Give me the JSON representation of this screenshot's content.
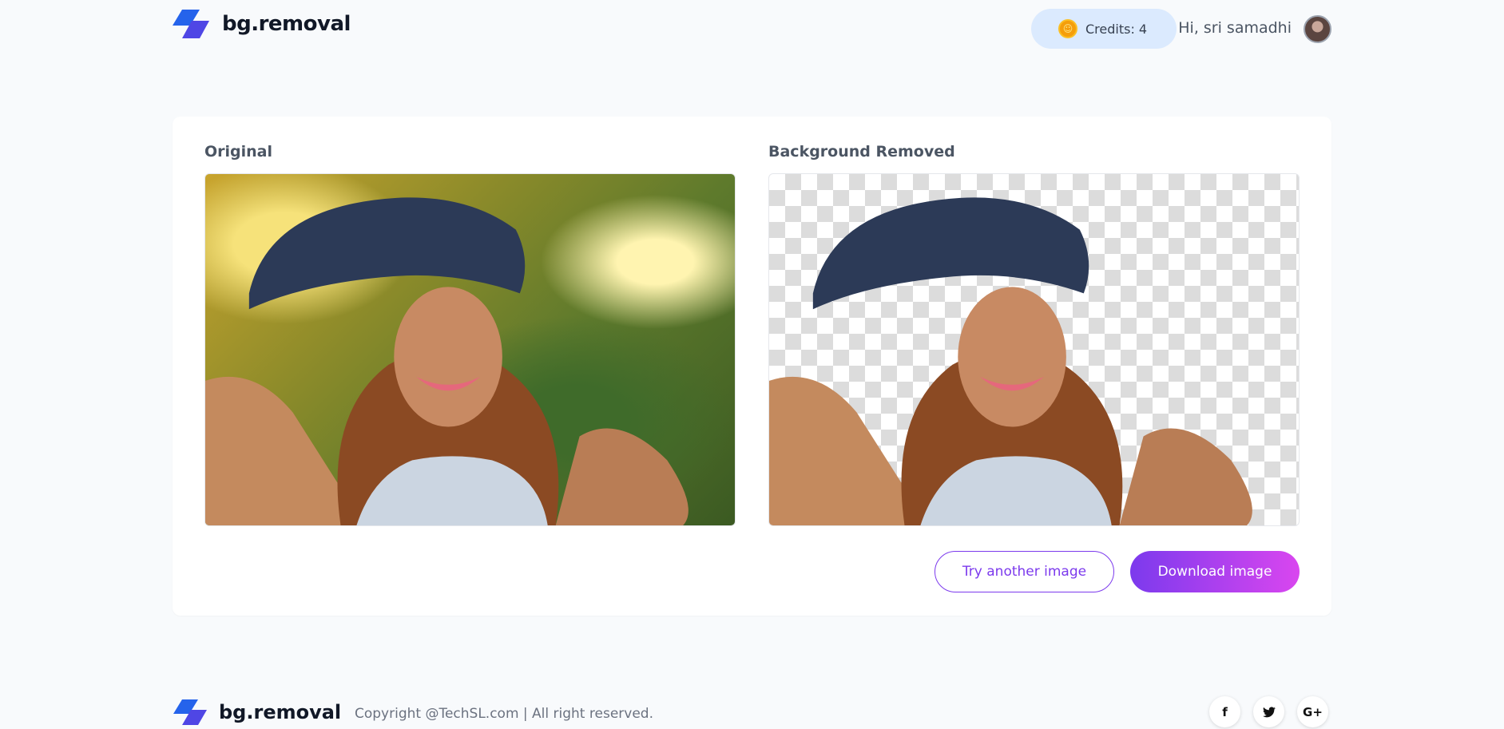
{
  "header": {
    "logo_text": "bg.removal",
    "credits_label": "Credits: 4",
    "greeting": "Hi, sri samadhi"
  },
  "main": {
    "original_title": "Original",
    "removed_title": "Background Removed",
    "try_label": "Try another image",
    "download_label": "Download image"
  },
  "footer": {
    "logo_text": "bg.removal",
    "copyright": "Copyright @TechSL.com | All right reserved.",
    "socials": [
      {
        "icon": "facebook-icon",
        "glyph": "f"
      },
      {
        "icon": "twitter-icon",
        "glyph": "🐦"
      },
      {
        "icon": "google-plus-icon",
        "glyph": "G+"
      }
    ]
  },
  "colors": {
    "brand_blue": "#2563eb",
    "accent_purple": "#7c3aed",
    "accent_pink": "#d946ef",
    "credits_bg": "#dbeafe"
  }
}
